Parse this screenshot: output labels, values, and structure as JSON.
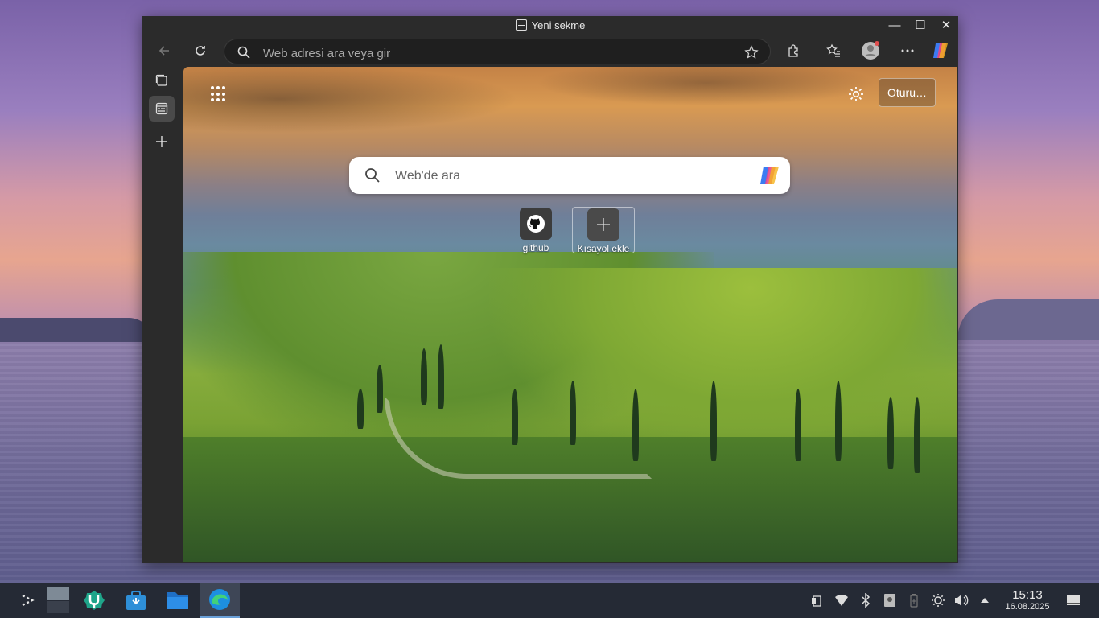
{
  "window": {
    "title": "Yeni sekme",
    "controls": {
      "minimize": "—",
      "maximize": "☐",
      "close": "✕"
    }
  },
  "toolbar": {
    "address_placeholder": "Web adresi ara veya gir",
    "icons": [
      "back-icon",
      "refresh-icon",
      "search-icon",
      "favorite-star-icon",
      "extensions-icon",
      "favorites-icon",
      "profile-icon",
      "more-icon",
      "copilot-icon"
    ]
  },
  "sidebar": {
    "icons": [
      "tab-actions-icon",
      "new-tab-page-icon",
      "add-icon"
    ]
  },
  "newtab": {
    "signin_label": "Oturu…",
    "search_placeholder": "Web'de ara",
    "shortcuts": [
      {
        "label": "github",
        "icon": "github-icon"
      },
      {
        "label": "Kısayol ekle",
        "icon": "plus-icon"
      }
    ]
  },
  "taskbar": {
    "apps": [
      "app-launcher-icon",
      "desktop-pager-icon",
      "discover-icon",
      "store-icon",
      "file-manager-icon",
      "edge-browser-icon"
    ],
    "tray_icons": [
      "clipboard-icon",
      "wifi-icon",
      "bluetooth-icon",
      "storage-icon",
      "battery-icon",
      "brightness-icon",
      "volume-icon",
      "expand-tray-icon",
      "show-desktop-icon"
    ],
    "clock_time": "15:13",
    "clock_date": "16.08.2025"
  },
  "colors": {
    "accent": "#6aa0d8",
    "window_bg": "#2b2b2b",
    "taskbar_bg": "#252a35"
  }
}
